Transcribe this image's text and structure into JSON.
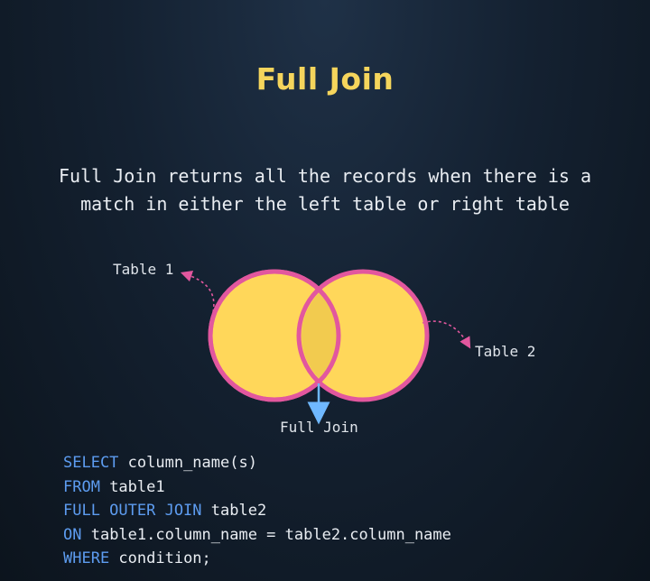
{
  "title": "Full Join",
  "description": {
    "line1": "Full Join returns all the records when there is a",
    "line2": "match in either the left table or right table"
  },
  "diagram": {
    "left_label": "Table 1",
    "right_label": "Table 2",
    "bottom_label": "Full Join",
    "circle_fill": "#ffd75a",
    "circle_stroke": "#e2579e",
    "overlap_fill": "#f2cb4f",
    "arrow_color": "#6fb8ff"
  },
  "code": {
    "line1": {
      "keyword": "SELECT",
      "rest": " column_name(s)"
    },
    "line2": {
      "keyword": "FROM",
      "rest": " table1"
    },
    "line3": {
      "keyword": "FULL OUTER JOIN",
      "rest": " table2"
    },
    "line4": {
      "keyword": "ON",
      "rest": " table1.column_name = table2.column_name"
    },
    "line5": {
      "keyword": "WHERE",
      "rest": " condition;"
    }
  }
}
